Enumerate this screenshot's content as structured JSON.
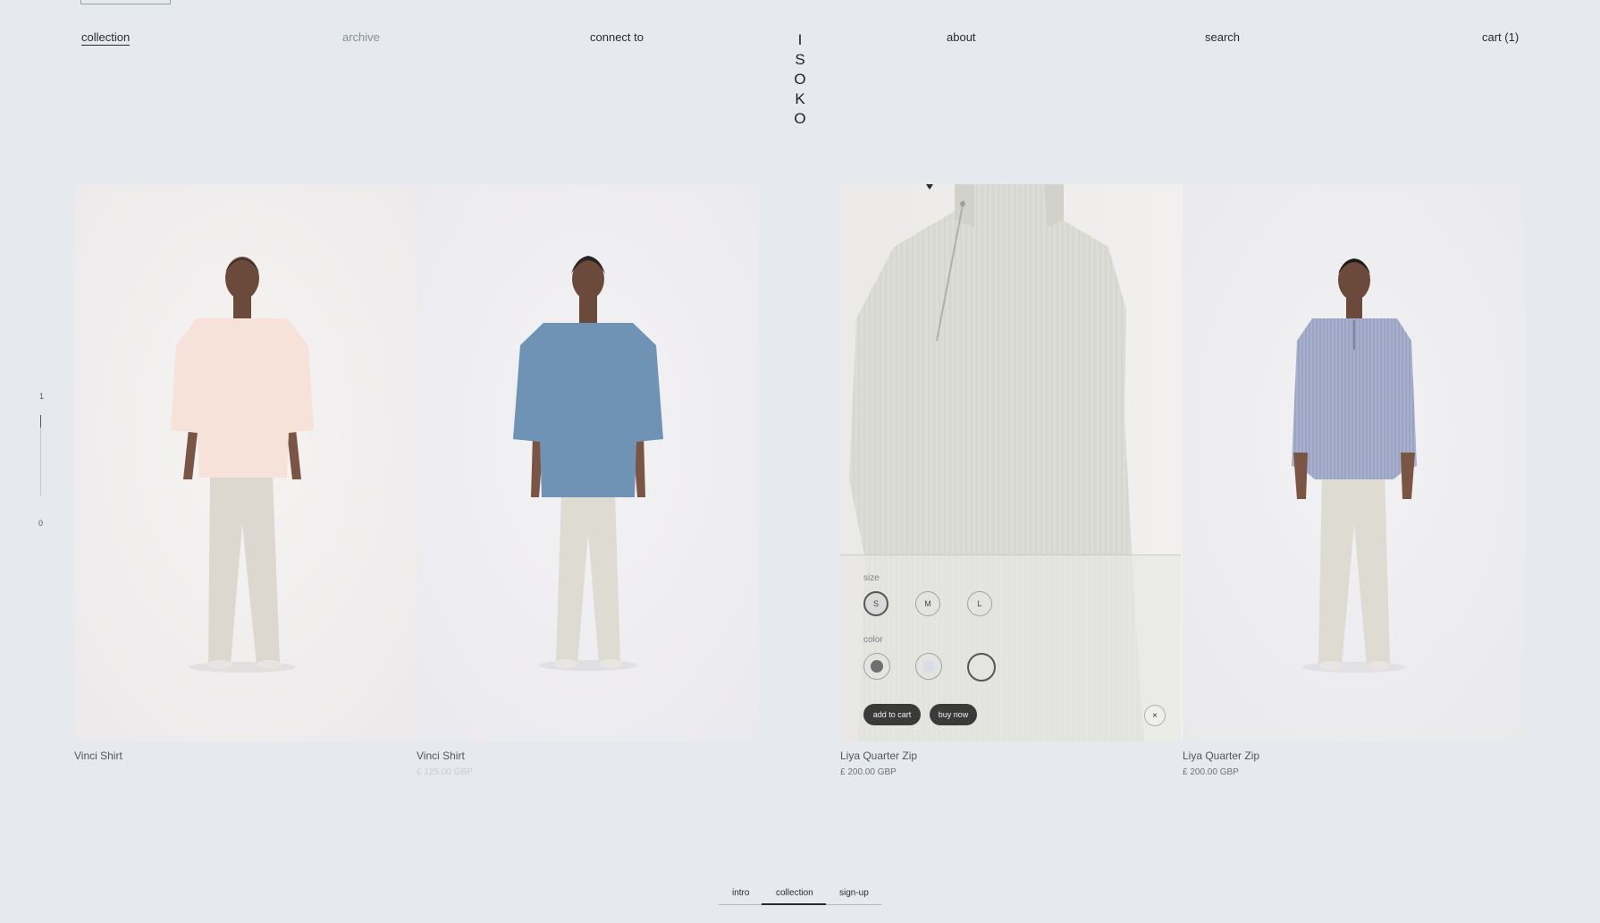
{
  "header": {
    "nav_left": [
      "collection",
      "archive",
      "connect to"
    ],
    "nav_right": [
      "about",
      "search",
      "cart (1)"
    ],
    "logo_letters": [
      "I",
      "S",
      "O",
      "K",
      "O"
    ]
  },
  "scroll_indicator": {
    "top": "1",
    "bottom": "0"
  },
  "products": [
    {
      "name": "Vinci Shirt",
      "price": ""
    },
    {
      "name": "Vinci Shirt",
      "price": "£ 125.00 GBP"
    },
    {
      "name": "Liya Quarter Zip",
      "price": "£ 200.00 GBP"
    },
    {
      "name": "Liya Quarter Zip",
      "price": "£ 200.00 GBP"
    }
  ],
  "quick_add": {
    "size_label": "size",
    "sizes": [
      "S",
      "M",
      "L"
    ],
    "selected_size": "S",
    "color_label": "color",
    "colors": [
      "#6f6f72",
      "#dcdce6",
      "#e4e4e1"
    ],
    "selected_color_index": 2,
    "add_to_cart": "add to cart",
    "buy_now": "buy now",
    "close_icon": "×"
  },
  "bottom_nav": [
    "intro",
    "collection",
    "sign-up"
  ],
  "colors": {
    "background": "#e6e9ee",
    "text": "#2b2b2b",
    "button": "#3a3a3a"
  }
}
